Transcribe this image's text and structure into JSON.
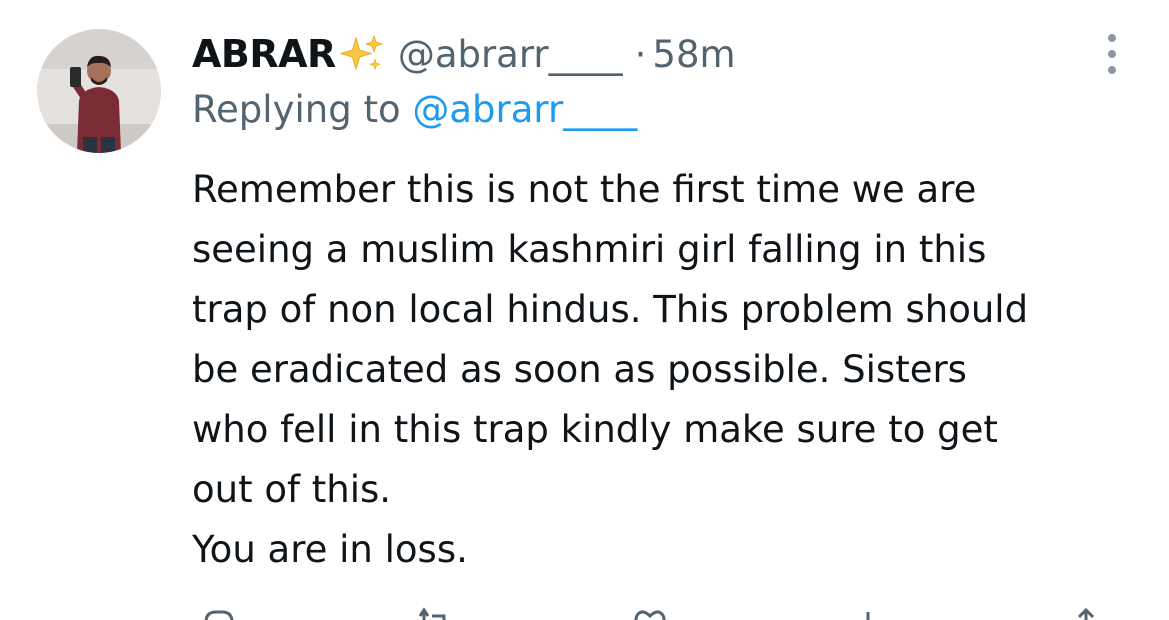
{
  "tweet": {
    "author_name": "ABRAR",
    "sparkle_emoji": "sparkles-icon",
    "handle": "@abrarr____",
    "separator": "·",
    "time": "58m",
    "reply_prefix": "Replying to",
    "reply_to": "@abrarr____",
    "text_lines": [
      "Remember this is not the first time we are",
      "seeing a muslim kashmiri girl falling in this",
      "trap of non local hindus. This problem should",
      "be eradicated as soon as possible. Sisters",
      "who fell in this trap kindly make sure to get",
      "out of this.",
      "You are in loss."
    ]
  },
  "icons": {
    "more": "more-vertical-icon",
    "reply": "reply-icon",
    "retweet": "retweet-icon",
    "like": "like-icon",
    "views": "views-icon",
    "share": "share-icon"
  },
  "colors": {
    "text": "#0f1419",
    "secondary": "#536471",
    "link": "#1d9bf0",
    "background": "#ffffff"
  }
}
